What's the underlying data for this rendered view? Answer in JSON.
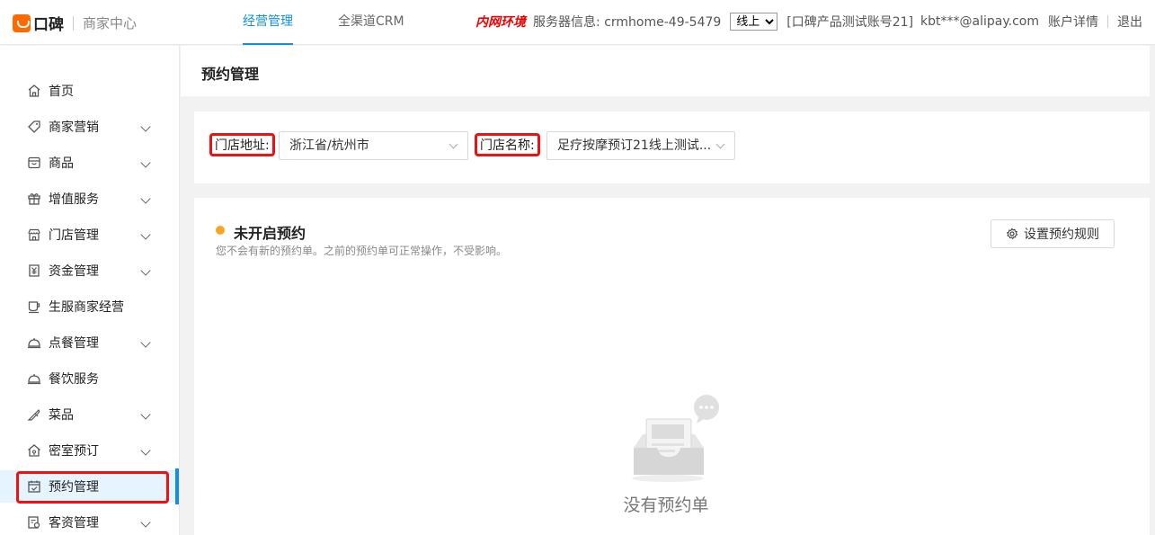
{
  "header": {
    "brand": "口碑",
    "subtitle": "商家中心",
    "nav": [
      {
        "label": "经营管理",
        "active": true
      },
      {
        "label": "全渠道CRM",
        "active": false
      }
    ],
    "env_label": "内网环境",
    "server_info": "服务器信息: crmhome-49-5479",
    "env_select": {
      "value": "线上",
      "options": [
        "线上"
      ]
    },
    "account": "[口碑产品测试账号21]",
    "email": "kbt***@alipay.com",
    "account_details": "账户详情",
    "logout": "退出"
  },
  "sidebar": {
    "items": [
      {
        "label": "首页",
        "icon": "home-icon",
        "has_children": false
      },
      {
        "label": "商家营销",
        "icon": "tag-icon",
        "has_children": true
      },
      {
        "label": "商品",
        "icon": "box-icon",
        "has_children": true
      },
      {
        "label": "增值服务",
        "icon": "gift-icon",
        "has_children": true
      },
      {
        "label": "门店管理",
        "icon": "store-icon",
        "has_children": true
      },
      {
        "label": "资金管理",
        "icon": "yuan-icon",
        "has_children": true
      },
      {
        "label": "生服商家经营",
        "icon": "cup-icon",
        "has_children": false
      },
      {
        "label": "点餐管理",
        "icon": "cloche-icon",
        "has_children": true
      },
      {
        "label": "餐饮服务",
        "icon": "cloche-icon",
        "has_children": false
      },
      {
        "label": "菜品",
        "icon": "knife-icon",
        "has_children": true
      },
      {
        "label": "密室预订",
        "icon": "house-icon",
        "has_children": true
      },
      {
        "label": "预约管理",
        "icon": "calendar-icon",
        "has_children": false,
        "active": true
      },
      {
        "label": "客资管理",
        "icon": "customer-icon",
        "has_children": true
      }
    ]
  },
  "page": {
    "title": "预约管理",
    "filters": {
      "address_label": "门店地址:",
      "address_value": "浙江省/杭州市",
      "store_label": "门店名称:",
      "store_value": "足疗按摩预订21线上测试..."
    },
    "status": {
      "title": "未开启预约",
      "description": "您不会有新的预约单。之前的预约单可正常操作，不受影响。",
      "dot_color": "#f5a623"
    },
    "rule_button": "设置预约规则",
    "empty_text": "没有预约单"
  },
  "colors": {
    "accent": "#108ee9",
    "highlight": "#ee1111",
    "brand": "#ff6a00"
  }
}
